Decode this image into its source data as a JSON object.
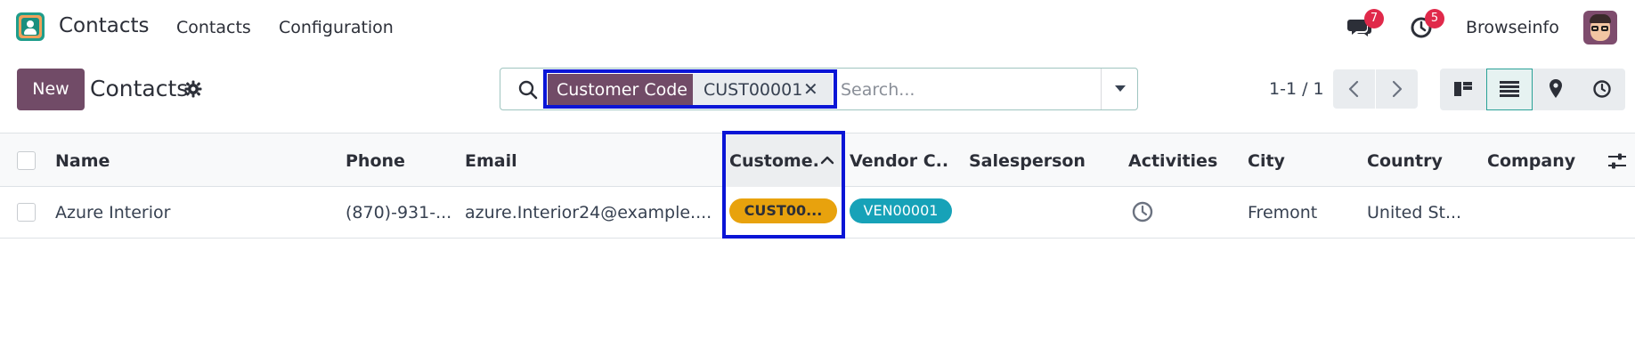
{
  "navbar": {
    "app_name": "Contacts",
    "menu": [
      "Contacts",
      "Configuration"
    ],
    "chat_badge": "7",
    "activity_badge": "5",
    "company": "Browseinfo"
  },
  "control_panel": {
    "new_label": "New",
    "title": "Contacts",
    "search": {
      "facet_label": "Customer Code",
      "facet_value": "CUST00001",
      "facet_remove": "✕",
      "placeholder": "Search..."
    },
    "pager": "1-1 / 1"
  },
  "table": {
    "columns": [
      "Name",
      "Phone",
      "Email",
      "Custome.",
      "Vendor C...",
      "Salesperson",
      "Activities",
      "City",
      "Country",
      "Company"
    ],
    "rows": [
      {
        "name": "Azure Interior",
        "phone": "(870)-931-...",
        "email": "azure.Interior24@example....",
        "customer_code": "CUST00...",
        "vendor_code": "VEN00001",
        "salesperson": "",
        "city": "Fremont",
        "country": "United St...",
        "company": ""
      }
    ]
  },
  "colors": {
    "brand": "#714b67",
    "highlight": "#0a15d6",
    "customer_pill": "#e8a20d",
    "vendor_pill": "#17a2b8",
    "badge": "#e0294a"
  }
}
